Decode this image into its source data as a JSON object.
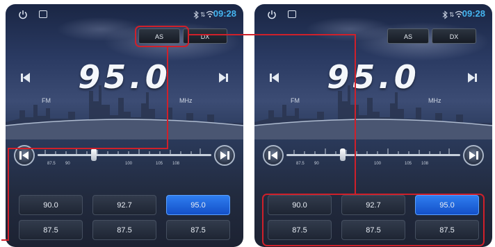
{
  "status": {
    "time": "09:28",
    "updown_glyph": "⇅"
  },
  "radio": {
    "frequency": "95.0",
    "band": "FM",
    "unit": "MHz",
    "mode_buttons": {
      "as": "AS",
      "dx": "DX"
    },
    "scale_labels": [
      "87.5",
      "90",
      "100",
      "105",
      "108"
    ],
    "presets": [
      "90.0",
      "92.7",
      "95.0",
      "87.5",
      "87.5",
      "87.5"
    ],
    "active_preset": 2
  },
  "colors": {
    "clock": "#45b5f0",
    "active_preset": "#2f7ef0",
    "highlight": "#d0202a"
  }
}
